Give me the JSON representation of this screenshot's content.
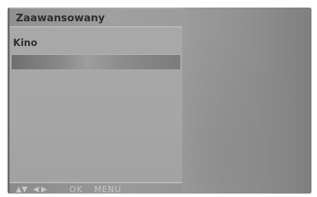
{
  "menu": {
    "title": "Zaawansowany",
    "item_label": "Kino",
    "highlight_value": ""
  },
  "footer": {
    "nav_updown_glyph": "▲▼",
    "nav_leftright_glyph": "◀ ▶",
    "ok_label": "OK",
    "menu_label": "MENU"
  },
  "colors": {
    "panel": "#a6a6a6",
    "text": "#2e2e2e",
    "footer_text": "#c8c8c8"
  }
}
